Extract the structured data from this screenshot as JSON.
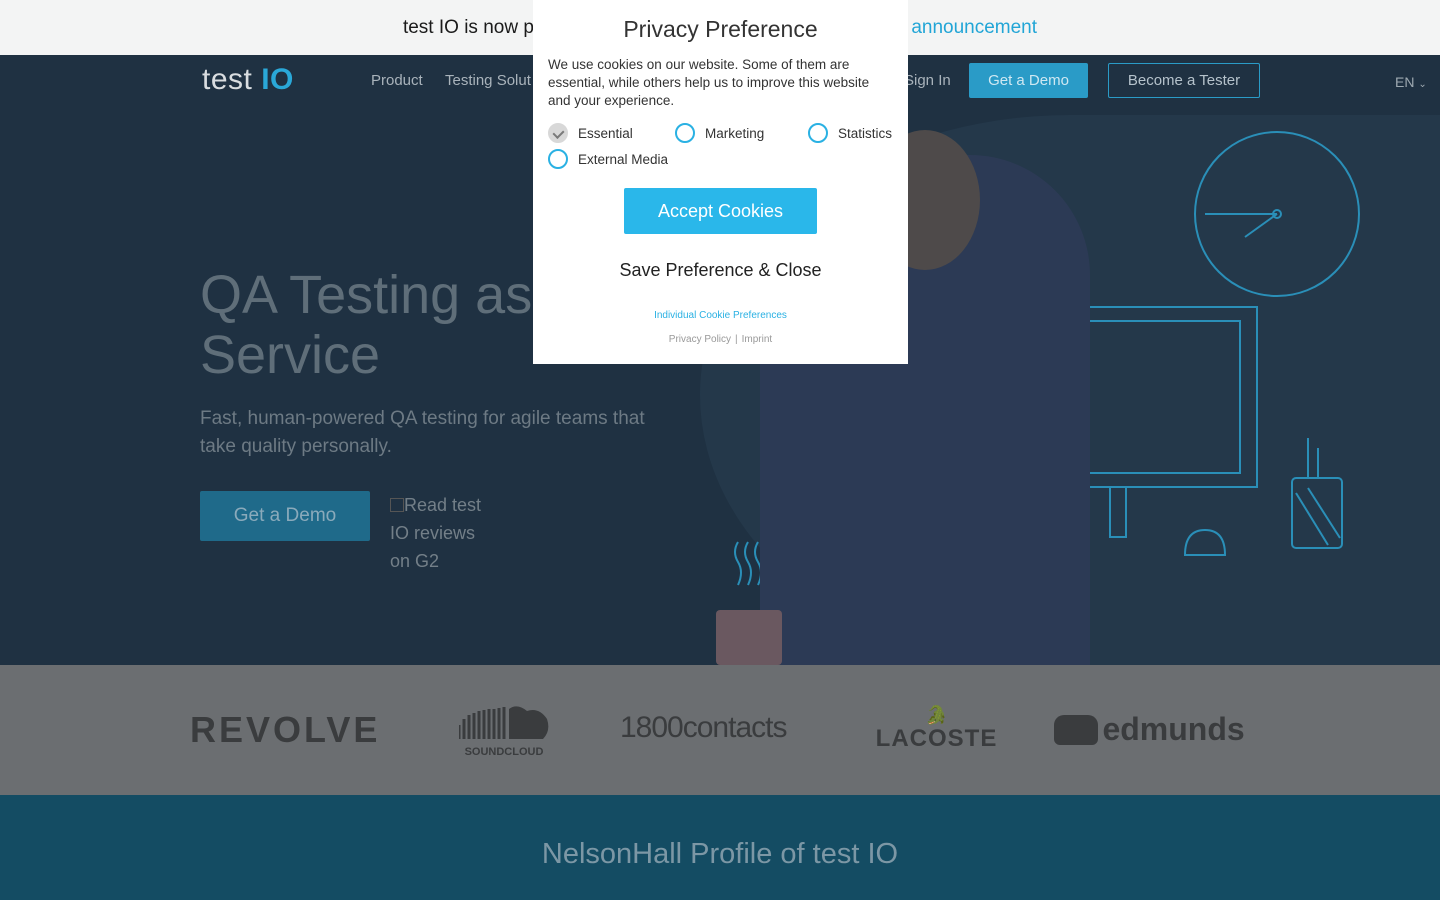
{
  "announcement": {
    "text": "test IO is now pa",
    "link": "e announcement"
  },
  "nav": {
    "logo_text": "test",
    "logo_accent": "IO",
    "links": [
      "Product",
      "Testing Solut"
    ],
    "sign_in": "Sign In",
    "get_demo": "Get a Demo",
    "become_tester": "Become a Tester",
    "language": "EN"
  },
  "hero": {
    "title_line1": "QA Testing as a",
    "title_line2": "Service",
    "subtitle": "Fast, human-powered QA testing for agile teams that take quality personally.",
    "cta": "Get a Demo",
    "g2_alt": "Read test IO reviews on G2"
  },
  "clients": [
    "REVOLVE",
    "SOUNDCLOUD",
    "1800contacts",
    "LACOSTE",
    "edmunds"
  ],
  "nelson": {
    "title": "NelsonHall Profile of test IO"
  },
  "modal": {
    "title": "Privacy Preference",
    "text": "We use cookies on our website. Some of them are essential, while others help us to improve this website and your experience.",
    "options": [
      {
        "label": "Essential",
        "checked": true
      },
      {
        "label": "Marketing",
        "checked": false
      },
      {
        "label": "Statistics",
        "checked": false
      },
      {
        "label": "External Media",
        "checked": false
      }
    ],
    "accept": "Accept Cookies",
    "save": "Save Preference & Close",
    "individual": "Individual Cookie Preferences",
    "privacy_policy": "Privacy Policy",
    "imprint": "Imprint"
  },
  "colors": {
    "accent": "#2ab7ea",
    "hero_bg": "#1f3142",
    "nelson_bg": "#144c63"
  }
}
